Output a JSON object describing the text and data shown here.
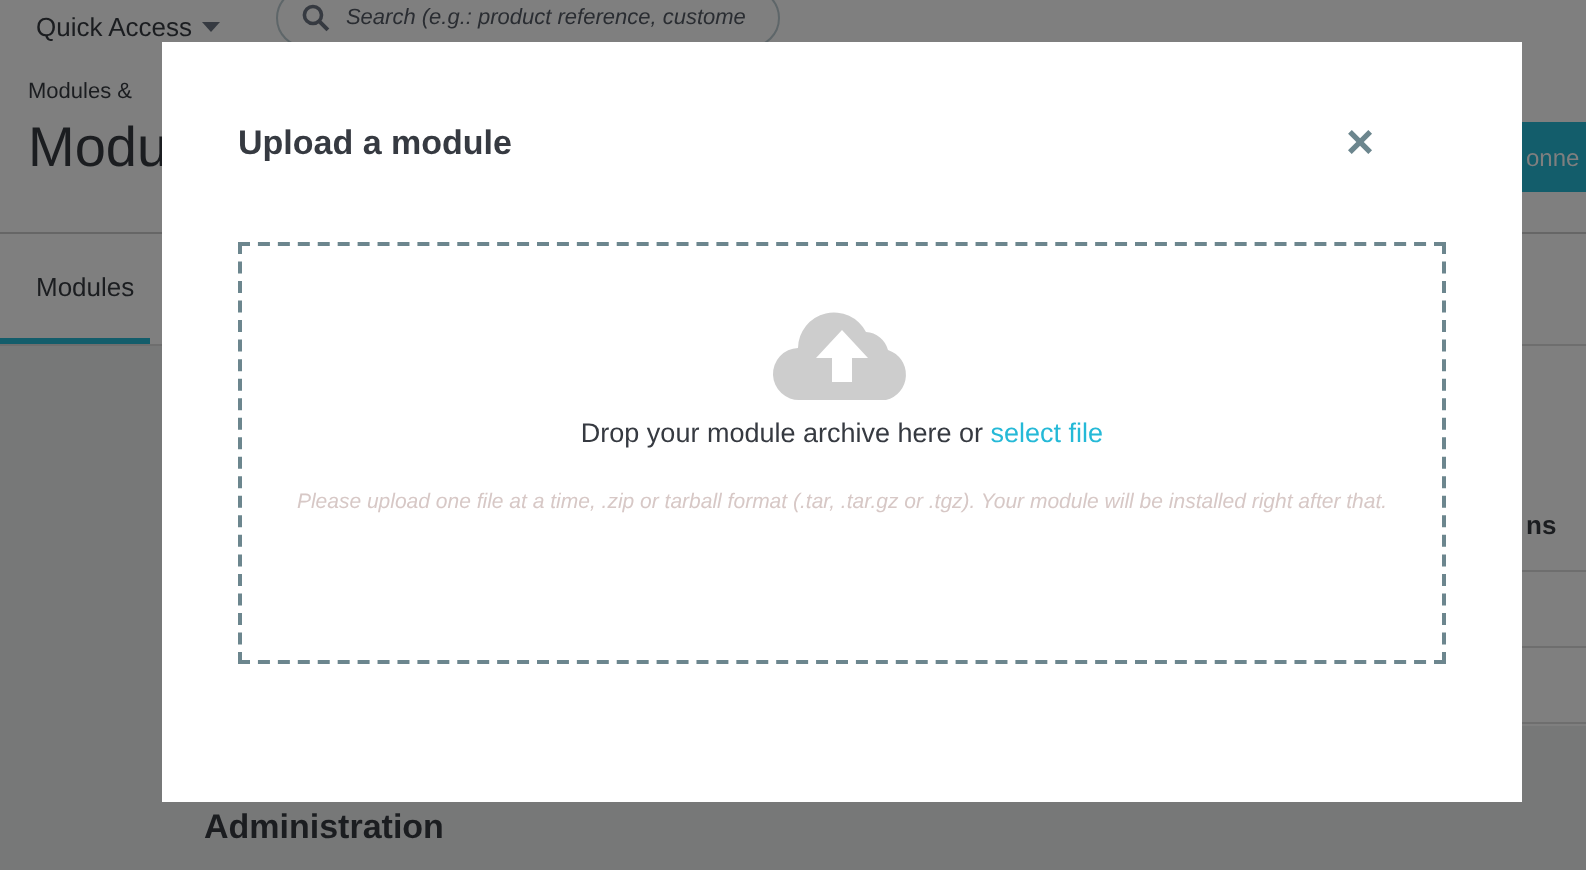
{
  "header": {
    "quick_access": "Quick Access",
    "search": {
      "placeholder": "Search (e.g.: product reference, custome"
    }
  },
  "breadcrumb": "Modules &",
  "page_title": "Modu",
  "header_button": "onne",
  "tabs": [
    {
      "label": "Modules",
      "selected": true
    }
  ],
  "panel_heading": "ns",
  "section_heading": "Administration",
  "modal": {
    "title": "Upload a module",
    "close": "×",
    "drop_text": "Drop your module archive here or ",
    "select_link": "select file",
    "hint": "Please upload one file at a time, .zip or tarball format (.tar, .tar.gz or .tgz). Your module will be installed right after that."
  }
}
